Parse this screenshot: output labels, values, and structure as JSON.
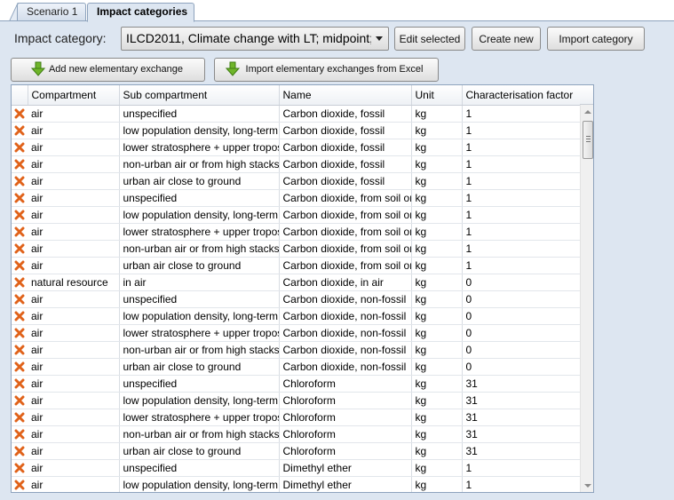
{
  "tabs": [
    {
      "label": "Scenario 1",
      "active": false
    },
    {
      "label": "Impact categories",
      "active": true
    }
  ],
  "toolbar": {
    "impact_category_label": "Impact category:",
    "impact_category_value": "ILCD2011, Climate change with LT; midpoint;",
    "edit_label": "Edit selected",
    "create_label": "Create new",
    "import_label": "Import category",
    "add_exchange_label": "Add new elementary exchange",
    "import_excel_label": "Import elementary exchanges from Excel"
  },
  "colors": {
    "accent_green": "#6fb52a",
    "delete_orange": "#e0621a"
  },
  "icons": {
    "download": "green-down-arrow-icon",
    "delete": "orange-x-icon"
  },
  "table": {
    "columns": [
      "Compartment",
      "Sub compartment",
      "Name",
      "Unit",
      "Characterisation factor"
    ],
    "rows": [
      [
        "air",
        "unspecified",
        "Carbon dioxide, fossil",
        "kg",
        "1"
      ],
      [
        "air",
        "low population density, long-term",
        "Carbon dioxide, fossil",
        "kg",
        "1"
      ],
      [
        "air",
        "lower stratosphere + upper troposphere",
        "Carbon dioxide, fossil",
        "kg",
        "1"
      ],
      [
        "air",
        "non-urban air or from high stacks",
        "Carbon dioxide, fossil",
        "kg",
        "1"
      ],
      [
        "air",
        "urban air close to ground",
        "Carbon dioxide, fossil",
        "kg",
        "1"
      ],
      [
        "air",
        "unspecified",
        "Carbon dioxide, from soil or biomass stock",
        "kg",
        "1"
      ],
      [
        "air",
        "low population density, long-term",
        "Carbon dioxide, from soil or biomass stock",
        "kg",
        "1"
      ],
      [
        "air",
        "lower stratosphere + upper troposphere",
        "Carbon dioxide, from soil or biomass stock",
        "kg",
        "1"
      ],
      [
        "air",
        "non-urban air or from high stacks",
        "Carbon dioxide, from soil or biomass stock",
        "kg",
        "1"
      ],
      [
        "air",
        "urban air close to ground",
        "Carbon dioxide, from soil or biomass stock",
        "kg",
        "1"
      ],
      [
        "natural resource",
        "in air",
        "Carbon dioxide, in air",
        "kg",
        "0"
      ],
      [
        "air",
        "unspecified",
        "Carbon dioxide, non-fossil",
        "kg",
        "0"
      ],
      [
        "air",
        "low population density, long-term",
        "Carbon dioxide, non-fossil",
        "kg",
        "0"
      ],
      [
        "air",
        "lower stratosphere + upper troposphere",
        "Carbon dioxide, non-fossil",
        "kg",
        "0"
      ],
      [
        "air",
        "non-urban air or from high stacks",
        "Carbon dioxide, non-fossil",
        "kg",
        "0"
      ],
      [
        "air",
        "urban air close to ground",
        "Carbon dioxide, non-fossil",
        "kg",
        "0"
      ],
      [
        "air",
        "unspecified",
        "Chloroform",
        "kg",
        "31"
      ],
      [
        "air",
        "low population density, long-term",
        "Chloroform",
        "kg",
        "31"
      ],
      [
        "air",
        "lower stratosphere + upper troposphere",
        "Chloroform",
        "kg",
        "31"
      ],
      [
        "air",
        "non-urban air or from high stacks",
        "Chloroform",
        "kg",
        "31"
      ],
      [
        "air",
        "urban air close to ground",
        "Chloroform",
        "kg",
        "31"
      ],
      [
        "air",
        "unspecified",
        "Dimethyl ether",
        "kg",
        "1"
      ],
      [
        "air",
        "low population density, long-term",
        "Dimethyl ether",
        "kg",
        "1"
      ]
    ]
  }
}
